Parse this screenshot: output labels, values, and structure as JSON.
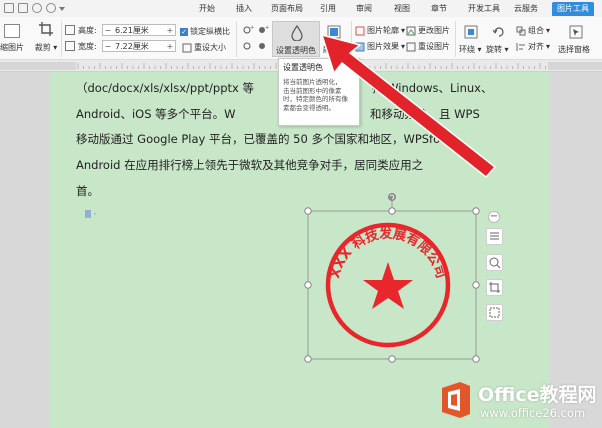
{
  "menu": {
    "tabs": [
      "开始",
      "插入",
      "页面布局",
      "引用",
      "审阅",
      "视图",
      "章节",
      "开发工具",
      "云服务",
      "图片工具"
    ],
    "active_tab": "图片工具"
  },
  "ribbon": {
    "crop_image_label": "缩图片",
    "crop_label": "裁剪",
    "height_label": "高度:",
    "height_value": "6.21厘米",
    "width_label": "宽度:",
    "width_value": "7.22厘米",
    "lock_ratio_label": "锁定纵横比",
    "reset_size_label": "重设大小",
    "transparent_label": "设置透明色",
    "color_label": "颜色",
    "picture_outline_label": "图片轮廓",
    "picture_effects_label": "图片效果",
    "change_picture_label": "更改图片",
    "reset_picture_label": "重设图片",
    "wrap_label": "环绕",
    "rotate_label": "旋转",
    "group_label": "组合",
    "align_label": "对齐",
    "select_pane_label": "选择窗格"
  },
  "tooltip": {
    "title": "设置透明色",
    "body": [
      "将当前图片透明化，",
      "击当前图形中的像素",
      "时，特定颜色的所有像",
      "素都会变得透明。"
    ]
  },
  "document": {
    "lines": [
      "（doc/docx/xls/xlsx/ppt/pptx 等",
      "Android、iOS 等多个平台。W",
      "移动版通过 Google Play 平台，已覆盖的 50 多个国家和地区，WPSfor",
      "Android 在应用排行榜上领先于微软及其他竞争对手，居同类应用之",
      "首。"
    ],
    "line1_tail": "持 Windows、Linux、",
    "line2_tail": "和移动办公。且 WPS"
  },
  "stamp": {
    "text": "XXX 科技发展有限公司",
    "color": "#e8262b"
  },
  "watermark": {
    "brand": "Office教程网",
    "url": "www.office26.com"
  },
  "colors": {
    "accent": "#2f8ddb",
    "page_bg": "#c8e6c8",
    "arrow": "#e3232a"
  }
}
